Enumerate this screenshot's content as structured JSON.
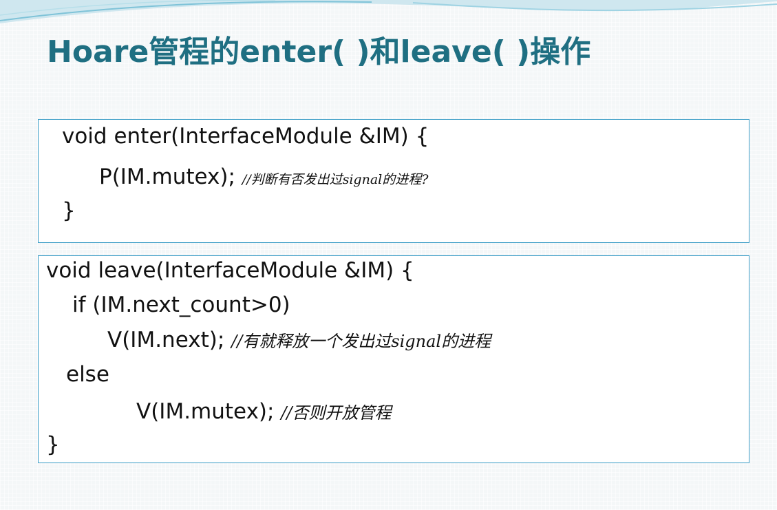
{
  "slide": {
    "title": "Hoare管程的enter( )和leave( )操作"
  },
  "enter_block": {
    "line1": "void enter(InterfaceModule &IM) {",
    "line2_code": "P(IM.mutex); ",
    "line2_comment": "//判断有否发出过signal的进程?",
    "line3": "}"
  },
  "leave_block": {
    "line1": "void leave(InterfaceModule &IM) {",
    "line2": "if (IM.next_count>0)",
    "line3_code": "V(IM.next);   ",
    "line3_comment": "//有就释放一个发出过signal的进程",
    "line4": "else",
    "line5_code": "V(IM.mutex); ",
    "line5_comment": "//否则开放管程",
    "line6": "}"
  },
  "colors": {
    "title": "#1f6f82",
    "box_border": "#3a9cc6",
    "text": "#111111",
    "background": "#f4f7f8"
  }
}
